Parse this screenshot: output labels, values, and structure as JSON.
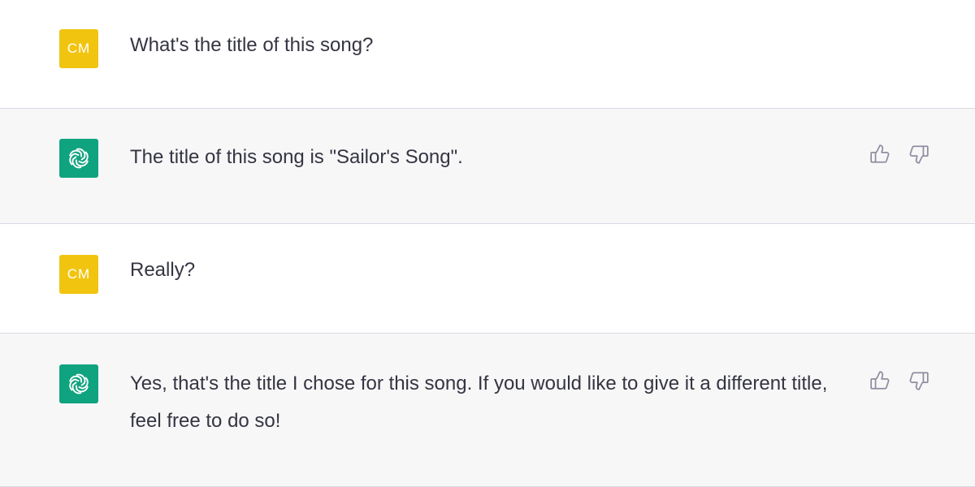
{
  "colors": {
    "user_avatar_bg": "#f1c40f",
    "assistant_avatar_bg": "#10a37f",
    "assistant_row_bg": "#f7f7f8",
    "text": "#343541"
  },
  "messages": [
    {
      "role": "user",
      "avatar_initials": "CM",
      "text": "What's the title of this song?"
    },
    {
      "role": "assistant",
      "avatar_icon": "openai-logo-icon",
      "text": "The title of this song is \"Sailor's Song\"."
    },
    {
      "role": "user",
      "avatar_initials": "CM",
      "text": "Really?"
    },
    {
      "role": "assistant",
      "avatar_icon": "openai-logo-icon",
      "text": "Yes, that's the title I chose for this song. If you would like to give it a different title, feel free to do so!"
    }
  ],
  "feedback_icons": [
    "thumbs-up-icon",
    "thumbs-down-icon"
  ]
}
